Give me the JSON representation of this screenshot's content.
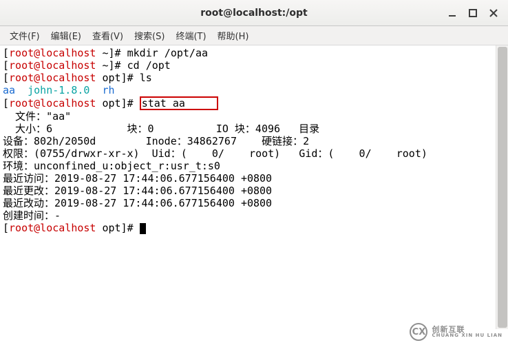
{
  "window": {
    "title": "root@localhost:/opt"
  },
  "menubar": {
    "file": "文件(F)",
    "edit": "编辑(E)",
    "view": "查看(V)",
    "search": "搜索(S)",
    "terminal": "终端(T)",
    "help": "帮助(H)"
  },
  "term": {
    "p1_user": "root@localhost",
    "p1_path": "~",
    "cmd1": "mkdir /opt/aa",
    "p2_user": "root@localhost",
    "p2_path": "~",
    "cmd2": "cd /opt",
    "p3_user": "root@localhost",
    "p3_path": "opt",
    "cmd3": "ls",
    "ls_aa": "aa",
    "ls_john": "john-1.8.0",
    "ls_rh": "rh",
    "p4_user": "root@localhost",
    "p4_path": "opt",
    "cmd4_pre": "# ",
    "cmd4_box": "stat aa     ",
    "stat_file_label": "  文件：",
    "stat_file_val": "\"aa\"",
    "stat_size_label": "  大小：",
    "stat_size_val": "6",
    "stat_blk_label": "块：",
    "stat_blk_val": "0",
    "stat_ioblk_label": "IO 块：",
    "stat_ioblk_val": "4096",
    "stat_type": "目录",
    "stat_dev_label": "设备：",
    "stat_dev_val": "802h/2050d",
    "stat_inode_label": "Inode：",
    "stat_inode_val": "34862767",
    "stat_links_label": "硬链接：",
    "stat_links_val": "2",
    "stat_perm_label": "权限：",
    "stat_perm_val": "(0755/drwxr-xr-x)",
    "stat_uid_label": "Uid：",
    "stat_uid_val": "(    0/    root)",
    "stat_gid_label": "Gid：",
    "stat_gid_val": "(    0/    root)",
    "stat_ctx_label": "环境：",
    "stat_ctx_val": "unconfined_u:object_r:usr_t:s0",
    "stat_atime_label": "最近访问：",
    "stat_atime_val": "2019-08-27 17:44:06.677156400 +0800",
    "stat_mtime_label": "最近更改：",
    "stat_mtime_val": "2019-08-27 17:44:06.677156400 +0800",
    "stat_ctime_label": "最近改动：",
    "stat_ctime_val": "2019-08-27 17:44:06.677156400 +0800",
    "stat_btime_label": "创建时间：",
    "stat_btime_val": "-",
    "p5_user": "root@localhost",
    "p5_path": "opt",
    "p5_tail": "# "
  },
  "watermark": {
    "badge": "CX",
    "line1": "创新互联",
    "line2": "CHUANG XIN HU LIAN"
  }
}
